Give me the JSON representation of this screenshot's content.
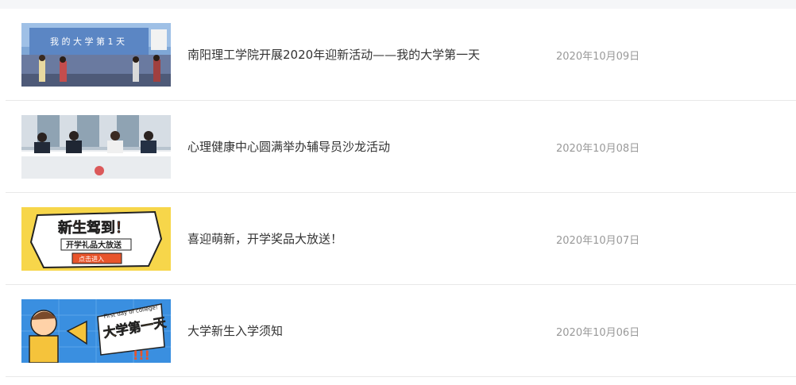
{
  "news": {
    "items": [
      {
        "title": "南阳理工学院开展2020年迎新活动——我的大学第一天",
        "date": "2020年10月09日",
        "thumb_text": "我 的 大 学 第 1 天"
      },
      {
        "title": "心理健康中心圆满举办辅导员沙龙活动",
        "date": "2020年10月08日"
      },
      {
        "title": "喜迎萌新，开学奖品大放送！",
        "date": "2020年10月07日",
        "thumb_text": "新生驾到！",
        "thumb_subtext": "开学礼品大放送",
        "thumb_button": "点击进入"
      },
      {
        "title": "大学新生入学须知",
        "date": "2020年10月06日",
        "thumb_text": "大学第一天",
        "thumb_subtext": "First day of college!",
        "thumb_marks": "!!!"
      }
    ]
  }
}
